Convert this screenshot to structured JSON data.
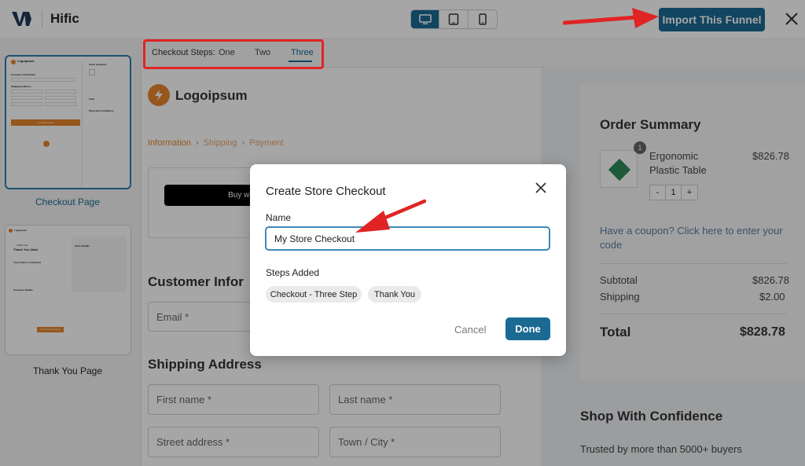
{
  "app": {
    "name": "Hific"
  },
  "header": {
    "import_label": "Import This Funnel"
  },
  "sidebar": {
    "items": [
      {
        "label": "Checkout Page"
      },
      {
        "label": "Thank You Page"
      }
    ],
    "thumb1": {
      "brand": "Logoipsum",
      "h1": "Customer Information",
      "h2": "Shipping Address",
      "summary": "Order Summary",
      "total": "Total",
      "confidence": "Shop with Confidence",
      "btn": "Complete Order"
    },
    "thumb2": {
      "brand": "Logoipsum",
      "small": "Thank You!",
      "title": "Thank You Jake!",
      "confirmed": "Your Order is Confirmed",
      "details": "Customer Details",
      "order": "Order Details",
      "button": "Continue Shopping"
    }
  },
  "steps": {
    "label": "Checkout Steps:",
    "items": [
      "One",
      "Two",
      "Three"
    ],
    "active": "Three"
  },
  "preview": {
    "logo_text": "Logoipsum",
    "breadcrumb": [
      "Information",
      "Shipping",
      "Payment"
    ],
    "buy_with": "Buy with",
    "customer_info": "Customer Infor",
    "email_placeholder": "Email *",
    "shipping_address": "Shipping Address",
    "first_name": "First name *",
    "last_name": "Last name *",
    "street": "Street address *",
    "town": "Town / City *"
  },
  "order_summary": {
    "title": "Order Summary",
    "product": {
      "name_line1": "Ergonomic",
      "name_line2": "Plastic Table",
      "price": "$826.78",
      "qty": "1",
      "badge": "1",
      "minus": "-",
      "plus": "+"
    },
    "coupon": "Have a coupon? Click here to enter your code",
    "subtotal_label": "Subtotal",
    "subtotal": "$826.78",
    "shipping_label": "Shipping",
    "shipping": "$2.00",
    "total_label": "Total",
    "total": "$828.78",
    "confidence_title": "Shop With Confidence",
    "confidence_text": "Trusted by more than 5000+ buyers"
  },
  "modal": {
    "title": "Create Store Checkout",
    "name_label": "Name",
    "name_value": "My Store Checkout",
    "steps_label": "Steps Added",
    "chips": [
      "Checkout - Three Step",
      "Thank You"
    ],
    "cancel": "Cancel",
    "done": "Done"
  },
  "colors": {
    "accent": "#1b6a94",
    "annotation": "#e02424",
    "orange": "#e8842c"
  }
}
